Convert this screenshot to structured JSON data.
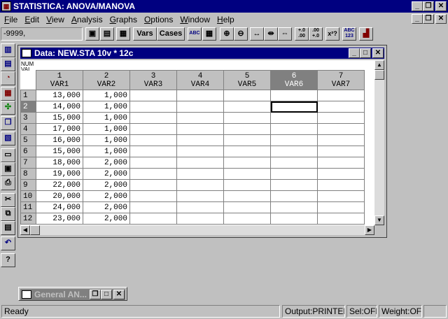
{
  "app": {
    "title": "STATISTICA: ANOVA/MANOVA",
    "buttons": {
      "minimize": "_",
      "restore": "❐",
      "close": "✕"
    }
  },
  "menu": [
    {
      "label": "File",
      "key": "F",
      "rest": "ile"
    },
    {
      "label": "Edit",
      "key": "E",
      "rest": "dit"
    },
    {
      "label": "View",
      "key": "V",
      "rest": "iew"
    },
    {
      "label": "Analysis",
      "key": "A",
      "rest": "nalysis"
    },
    {
      "label": "Graphs",
      "key": "G",
      "rest": "raphs"
    },
    {
      "label": "Options",
      "key": "O",
      "rest": "ptions"
    },
    {
      "label": "Window",
      "key": "W",
      "rest": "indow"
    },
    {
      "label": "Help",
      "key": "H",
      "rest": "elp"
    }
  ],
  "toolbar": {
    "value_box": "-9999,",
    "vars_label": "Vars",
    "cases_label": "Cases",
    "abc_label": "ABC",
    "decimals_more": "+.0\n.00",
    "decimals_less": ".00\n+.0",
    "xsq_label": "x²?",
    "abc123_label": "ABC\n123"
  },
  "data_window": {
    "title": "Data: NEW.STA 10v * 12c",
    "corner_line1": "NUM",
    "corner_line2": "VAL",
    "columns": [
      {
        "num": "1",
        "name": "VAR1"
      },
      {
        "num": "2",
        "name": "VAR2"
      },
      {
        "num": "3",
        "name": "VAR3"
      },
      {
        "num": "4",
        "name": "VAR4"
      },
      {
        "num": "5",
        "name": "VAR5"
      },
      {
        "num": "6",
        "name": "VAR6"
      },
      {
        "num": "7",
        "name": "VAR7"
      }
    ],
    "selected_column": 5,
    "selected_row": 1,
    "rows": [
      {
        "n": "1",
        "v1": "13,000",
        "v2": "1,000"
      },
      {
        "n": "2",
        "v1": "14,000",
        "v2": "1,000"
      },
      {
        "n": "3",
        "v1": "15,000",
        "v2": "1,000"
      },
      {
        "n": "4",
        "v1": "17,000",
        "v2": "1,000"
      },
      {
        "n": "5",
        "v1": "16,000",
        "v2": "1,000"
      },
      {
        "n": "6",
        "v1": "15,000",
        "v2": "1,000"
      },
      {
        "n": "7",
        "v1": "18,000",
        "v2": "2,000"
      },
      {
        "n": "8",
        "v1": "19,000",
        "v2": "2,000"
      },
      {
        "n": "9",
        "v1": "22,000",
        "v2": "2,000"
      },
      {
        "n": "10",
        "v1": "20,000",
        "v2": "2,000"
      },
      {
        "n": "11",
        "v1": "24,000",
        "v2": "2,000"
      },
      {
        "n": "12",
        "v1": "23,000",
        "v2": "2,000"
      }
    ]
  },
  "minimized_window": {
    "title": "General AN..."
  },
  "status": {
    "ready": "Ready",
    "output": "Output:PRINTER",
    "sel": "Sel:OFF",
    "weight": "Weight:OFF"
  },
  "colors": {
    "titlebar": "#000080",
    "face": "#c0c0c0",
    "selected_header": "#808080"
  }
}
